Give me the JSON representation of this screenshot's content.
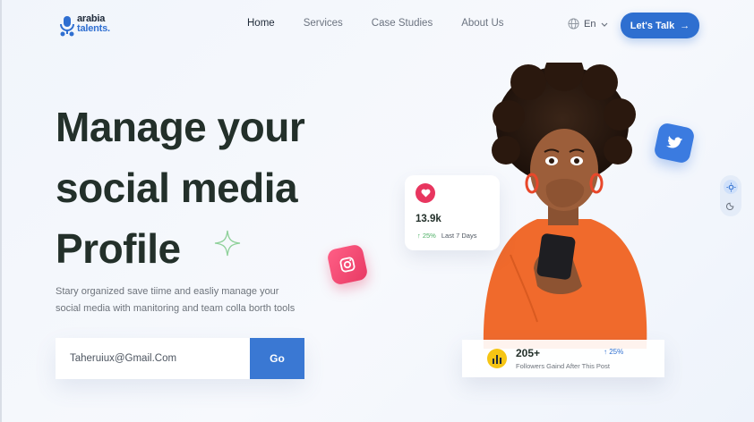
{
  "brand": {
    "line1": "arabia",
    "line2": "talents."
  },
  "nav": {
    "items": [
      "Home",
      "Services",
      "Case Studies",
      "About Us"
    ],
    "active": "Home"
  },
  "language": {
    "label": "En"
  },
  "cta": {
    "label": "Let's Talk",
    "arrow": "→"
  },
  "hero": {
    "headline_line1": "Manage your",
    "headline_line2": "social media",
    "headline_line3": "Profile",
    "subtitle_line1": "Stary organized save tiime and easliy manage your",
    "subtitle_line2": "social media with manitoring and team colla borth tools"
  },
  "signup": {
    "email_value": "Taheruiux@Gmail.Com",
    "button_label": "Go"
  },
  "stat_card": {
    "value": "13.9k",
    "percent": "25%",
    "period": "Last 7 Days"
  },
  "followers_card": {
    "value": "205+",
    "percent": "25%",
    "label": "Followers Gaind After This Post"
  },
  "colors": {
    "primary": "#2e6fd0",
    "instagram": "#e83a64",
    "twitter": "#3b7be0",
    "heading": "#23302a",
    "accent_yellow": "#f6c514"
  },
  "icons": [
    "logo-mark-icon",
    "globe-icon",
    "chevron-down-icon",
    "arrow-right-icon",
    "sparkle-icon",
    "instagram-icon",
    "twitter-icon",
    "heart-icon",
    "arrow-up-icon",
    "bar-chart-icon",
    "sun-icon",
    "moon-icon"
  ]
}
